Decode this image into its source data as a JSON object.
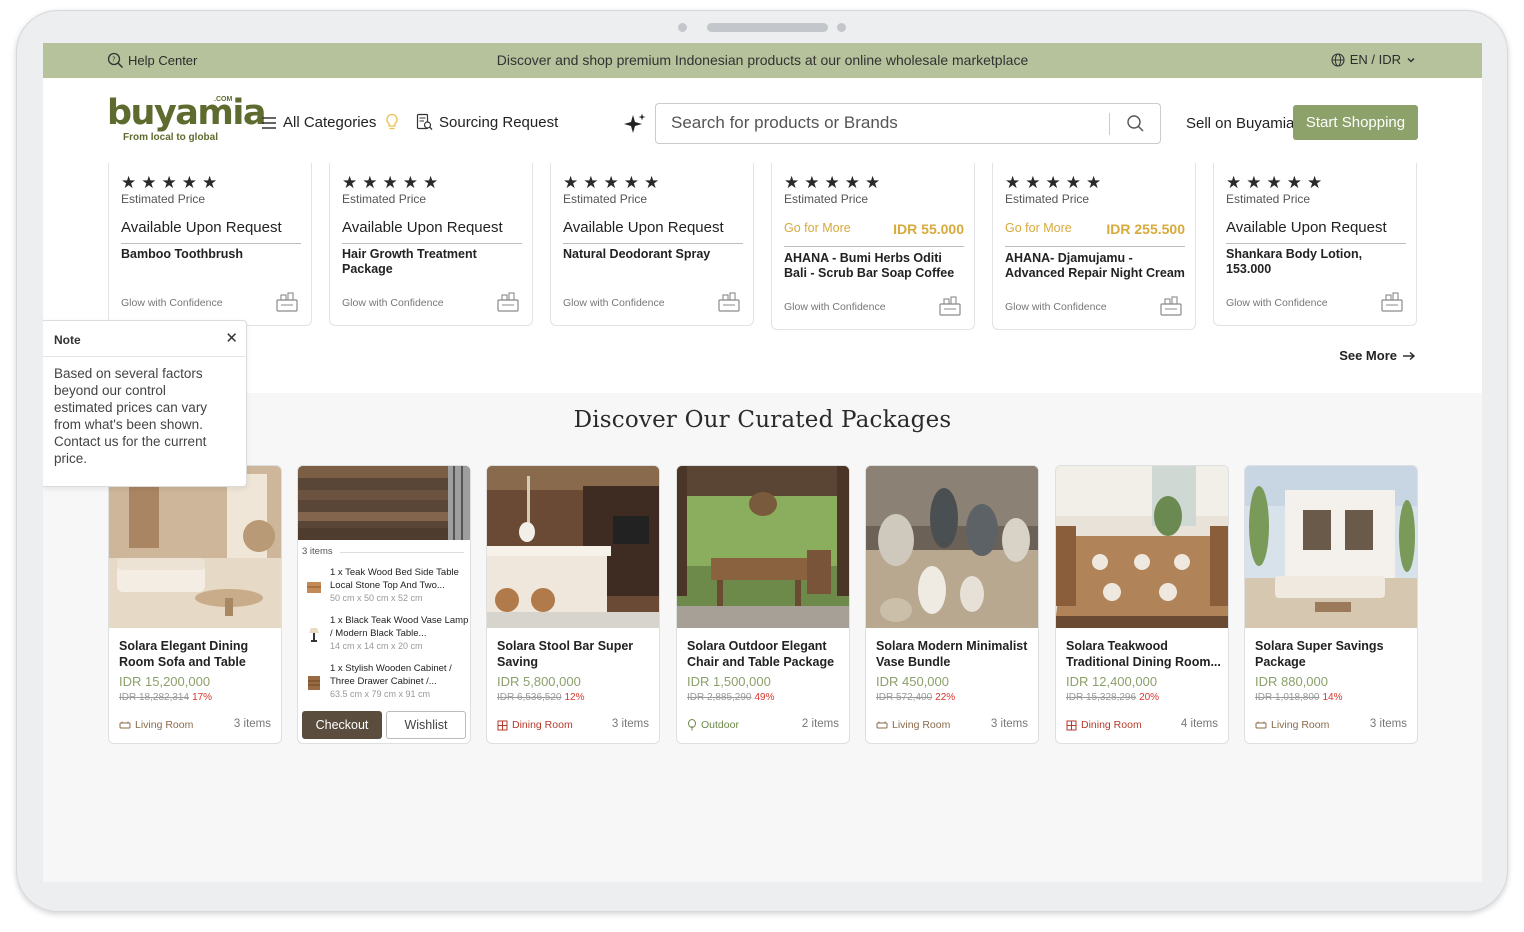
{
  "topbar": {
    "help": "Help Center",
    "promo": "Discover and shop premium Indonesian products at our online wholesale marketplace",
    "lang": "EN / IDR"
  },
  "header": {
    "logo_word": "buyamia",
    "logo_com": ".COM",
    "logo_tagline": "From local to global",
    "all_categories": "All Categories",
    "sourcing_request": "Sourcing Request",
    "search_placeholder": "Search for products or Brands",
    "sell": "Sell on Buyamia",
    "start": "Start Shopping"
  },
  "products": [
    {
      "stars": "★★★★★",
      "est": "Estimated Price",
      "price_text": "Available Upon Request",
      "name": "Bamboo Toothbrush",
      "seller": "Glow with Confidence"
    },
    {
      "stars": "★★★★★",
      "est": "Estimated Price",
      "price_text": "Available Upon Request",
      "name": "Hair Growth Treatment Package",
      "seller": "Glow with Confidence"
    },
    {
      "stars": "★★★★★",
      "est": "Estimated Price",
      "price_text": "Available Upon Request",
      "name": "Natural Deodorant Spray",
      "seller": "Glow with Confidence"
    },
    {
      "stars": "★★★★★",
      "est": "Estimated Price",
      "go_for": "Go for More",
      "price": "IDR 55.000",
      "name": "AHANA - Bumi Herbs Oditi Bali - Scrub Bar Soap Coffee",
      "seller": "Glow with Confidence"
    },
    {
      "stars": "★★★★★",
      "est": "Estimated Price",
      "go_for": "Go for More",
      "price": "IDR 255.500",
      "name": "AHANA- Djamujamu - Advanced Repair Night Cream",
      "seller": "Glow with Confidence"
    },
    {
      "stars": "★★★★★",
      "est": "Estimated Price",
      "price_text": "Available Upon Request",
      "name": "Shankara Body Lotion, 153.000",
      "seller": "Glow with Confidence"
    }
  ],
  "see_more": "See More",
  "note": {
    "title": "Note",
    "close": "✕",
    "body": "Based on several factors beyond our control estimated prices can vary from what's been shown. Contact us for the current price."
  },
  "curated_title": "Discover Our Curated Packages",
  "packages": [
    {
      "name": "Solara Elegant Dining Room Sofa and Table",
      "price": "IDR 15,200,000",
      "orig": "IDR 18,282,314",
      "disc": "17%",
      "cat": "Living Room",
      "items": "3 items"
    },
    {
      "name": "Solara Stool Bar Super Saving",
      "price": "IDR 5,800,000",
      "orig": "IDR 6,536,520",
      "disc": "12%",
      "cat": "Dining Room",
      "items": "3 items"
    },
    {
      "name": "Solara Outdoor Elegant Chair and Table Package",
      "price": "IDR 1,500,000",
      "orig": "IDR 2,885,290",
      "disc": "49%",
      "cat": "Outdoor",
      "items": "2 items"
    },
    {
      "name": "Solara Modern Minimalist Vase Bundle",
      "price": "IDR 450,000",
      "orig": "IDR 572,400",
      "disc": "22%",
      "cat": "Living Room",
      "items": "3 items"
    },
    {
      "name": "Solara Teakwood Traditional Dining Room...",
      "price": "IDR 12,400,000",
      "orig": "IDR 15,328,296",
      "disc": "20%",
      "cat": "Dining Room",
      "items": "4 items"
    },
    {
      "name": "Solara Super Savings Package",
      "price": "IDR 880,000",
      "orig": "IDR 1,018,800",
      "disc": "14%",
      "cat": "Living Room",
      "items": "3 items"
    }
  ],
  "hover_package": {
    "count": "3 items",
    "items": [
      {
        "title": "1 x Teak Wood Bed Side Table Local Stone Top And Two...",
        "dims": "50 cm x 50 cm x 52 cm"
      },
      {
        "title": "1 x Black Teak Wood Vase Lamp / Modern Black Table...",
        "dims": "14 cm x 14 cm x 20 cm"
      },
      {
        "title": "1 x Stylish Wooden Cabinet / Three Drawer Cabinet /...",
        "dims": "63.5 cm x 79 cm x 91 cm"
      }
    ],
    "checkout": "Checkout",
    "wishlist": "Wishlist"
  }
}
